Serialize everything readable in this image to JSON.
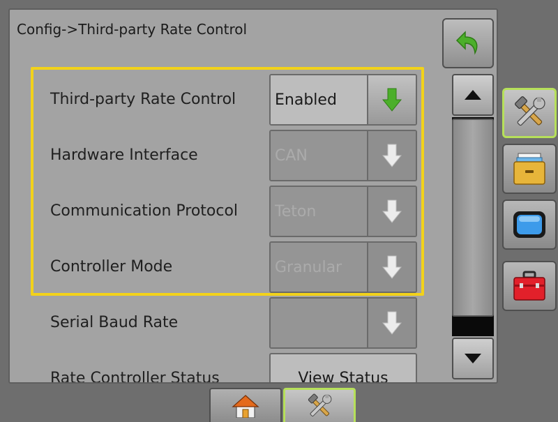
{
  "header": {
    "title": "Config->Third-party Rate Control"
  },
  "settings": [
    {
      "label": "Third-party Rate Control",
      "value": "Enabled",
      "state": "enabled",
      "arrow_color": "#4caf2a"
    },
    {
      "label": "Hardware Interface",
      "value": "CAN",
      "state": "disabled",
      "arrow_color": "#e8e8e8"
    },
    {
      "label": "Communication Protocol",
      "value": "Teton",
      "state": "disabled",
      "arrow_color": "#e8e8e8"
    },
    {
      "label": "Controller Mode",
      "value": "Granular",
      "state": "disabled",
      "arrow_color": "#e8e8e8"
    },
    {
      "label": "Serial Baud Rate",
      "value": "",
      "state": "disabled",
      "arrow_color": "#e8e8e8"
    }
  ],
  "status_row": {
    "label": "Rate Controller Status",
    "button_label": "View Status"
  },
  "side_nav": [
    {
      "icon": "tools-icon",
      "active": true
    },
    {
      "icon": "file-drawer-icon",
      "active": false
    },
    {
      "icon": "monitor-icon",
      "active": false
    },
    {
      "icon": "toolbox-icon",
      "active": false
    }
  ],
  "bottom_tabs": [
    {
      "icon": "home-icon",
      "active": false
    },
    {
      "icon": "tools-icon",
      "active": true
    }
  ],
  "colors": {
    "highlight": "#f2d21a",
    "active_border": "#b6e05a",
    "back_arrow": "#4caf2a"
  }
}
